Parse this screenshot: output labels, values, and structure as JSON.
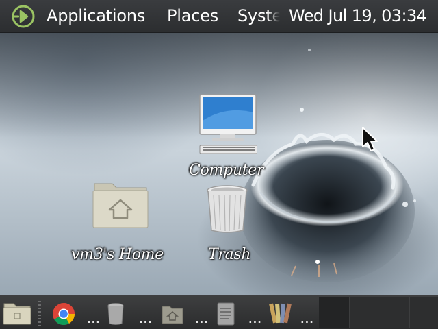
{
  "top_panel": {
    "menus": {
      "applications": "Applications",
      "places": "Places",
      "system": "System"
    },
    "clock": "Wed Jul 19, 03:34",
    "logo_icon": "linux-mint-menu-icon"
  },
  "desktop": {
    "icons": {
      "computer": {
        "label": "Computer",
        "icon": "computer-monitor-icon"
      },
      "home": {
        "label": "vm3's Home",
        "icon": "home-folder-icon"
      },
      "trash": {
        "label": "Trash",
        "icon": "trash-can-icon"
      }
    }
  },
  "taskbar": {
    "items": [
      {
        "icon": "show-desktop-folder-icon",
        "label": ""
      },
      {
        "icon": "chrome-icon",
        "label": "..."
      },
      {
        "icon": "trash-can-icon",
        "label": "..."
      },
      {
        "icon": "home-folder-icon",
        "label": "..."
      },
      {
        "icon": "text-document-icon",
        "label": "..."
      },
      {
        "icon": "color-palette-icon",
        "label": "..."
      }
    ]
  },
  "colors": {
    "panel": "#2f3133",
    "panel_text": "#ffffff",
    "mint_green": "#8fc150"
  }
}
